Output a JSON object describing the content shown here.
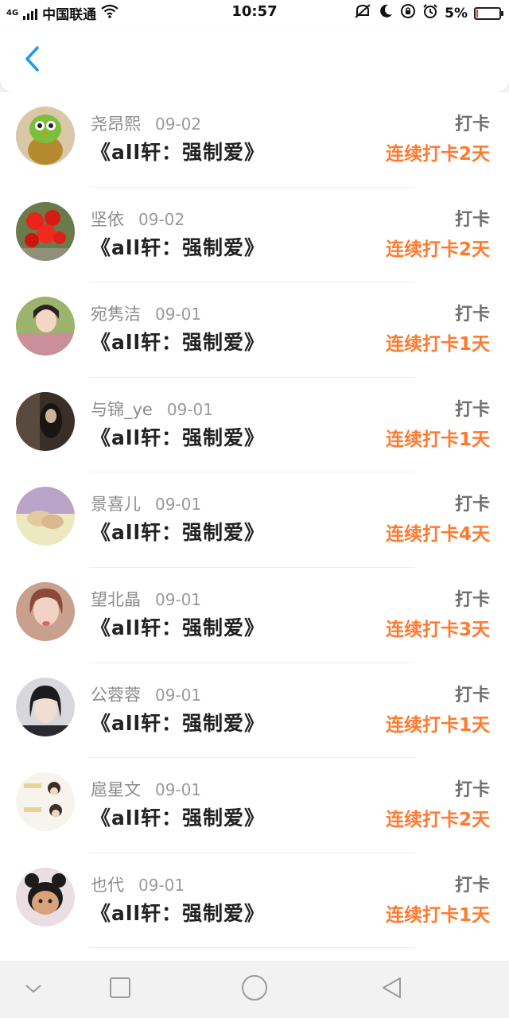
{
  "status_bar": {
    "network": "4G",
    "carrier": "中国联通",
    "time": "10:57",
    "battery_percent": "5%",
    "battery_level": 0.05,
    "battery_color": "#e53935",
    "icons": [
      "signal-icon",
      "wifi-icon",
      "silent-icon",
      "moon-icon",
      "rotation-lock-icon",
      "alarm-icon",
      "battery-icon"
    ]
  },
  "header": {
    "back_icon": "chevron-left-icon",
    "accent": "#2196f3"
  },
  "list": {
    "items": [
      {
        "name": "尧昂熙",
        "date": "09-02",
        "book": "《all轩：强制爱》",
        "action": "打卡",
        "streak": "连续打卡2天"
      },
      {
        "name": "坚依",
        "date": "09-02",
        "book": "《all轩：强制爱》",
        "action": "打卡",
        "streak": "连续打卡2天"
      },
      {
        "name": "宛隽洁",
        "date": "09-01",
        "book": "《all轩：强制爱》",
        "action": "打卡",
        "streak": "连续打卡1天"
      },
      {
        "name": "与锦_ye",
        "date": "09-01",
        "book": "《all轩：强制爱》",
        "action": "打卡",
        "streak": "连续打卡1天"
      },
      {
        "name": "景喜儿",
        "date": "09-01",
        "book": "《all轩：强制爱》",
        "action": "打卡",
        "streak": "连续打卡4天"
      },
      {
        "name": "望北晶",
        "date": "09-01",
        "book": "《all轩：强制爱》",
        "action": "打卡",
        "streak": "连续打卡3天"
      },
      {
        "name": "公蓉蓉",
        "date": "09-01",
        "book": "《all轩：强制爱》",
        "action": "打卡",
        "streak": "连续打卡1天"
      },
      {
        "name": "扈星文",
        "date": "09-01",
        "book": "《all轩：强制爱》",
        "action": "打卡",
        "streak": "连续打卡2天"
      },
      {
        "name": "也代",
        "date": "09-01",
        "book": "《all轩：强制爱》",
        "action": "打卡",
        "streak": "连续打卡1天"
      }
    ]
  },
  "colors": {
    "streak": "#ff7a2e",
    "name": "#8c8c8c",
    "book": "#222222"
  },
  "nav_bar": {
    "icons": [
      "collapse-down-icon",
      "recents-square-icon",
      "home-circle-icon",
      "back-triangle-icon"
    ]
  }
}
